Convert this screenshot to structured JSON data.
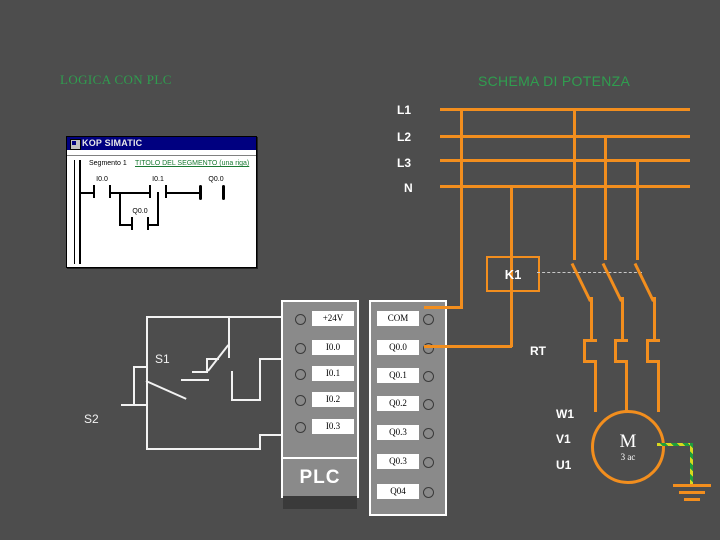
{
  "page": {
    "background_color": "#4d4d4d",
    "accent_orange": "#f28e1e",
    "accent_green": "#2f9e4f",
    "wire_white": "#f2f2f2"
  },
  "headings": {
    "left": "LOGICA CON PLC",
    "right": "SCHEMA DI POTENZA"
  },
  "ladder_window": {
    "title": "KOP SIMATIC",
    "segment_label": "Segmento 1",
    "segment_title": "TITOLO DEL SEGMENTO (una riga)",
    "contacts": [
      {
        "id": "I0.0",
        "type": "no"
      },
      {
        "id": "I0.1",
        "type": "nc"
      }
    ],
    "coil": "Q0.0",
    "branch_contact": "Q0.0"
  },
  "control_circuit": {
    "switches": [
      {
        "label": "S1",
        "type": "normally-closed-pushbutton"
      },
      {
        "label": "S2",
        "type": "normally-open-pushbutton"
      }
    ]
  },
  "plc": {
    "label": "PLC",
    "input_terminals": [
      {
        "label": "+24V",
        "wired": true
      },
      {
        "label": "I0.0",
        "wired": true
      },
      {
        "label": "I0.1",
        "wired": true
      },
      {
        "label": "I0.2",
        "wired": false
      },
      {
        "label": "I0.3",
        "wired": false
      }
    ],
    "output_terminals": [
      {
        "label": "COM",
        "wired": true
      },
      {
        "label": "Q0.0",
        "wired": true
      },
      {
        "label": "Q0.1",
        "wired": false
      },
      {
        "label": "Q0.2",
        "wired": false
      },
      {
        "label": "Q0.3",
        "wired": false
      },
      {
        "label": "Q0.3",
        "wired": false
      },
      {
        "label": "Q04",
        "wired": false
      }
    ]
  },
  "power_diagram": {
    "rails": [
      "L1",
      "L2",
      "L3",
      "N"
    ],
    "contactor": {
      "label": "K1",
      "poles": 3
    },
    "thermal_relay": {
      "label": "RT"
    },
    "motor": {
      "symbol": "M",
      "type": "3 ac",
      "terminals": [
        "W1",
        "V1",
        "U1"
      ],
      "earth": true
    }
  }
}
